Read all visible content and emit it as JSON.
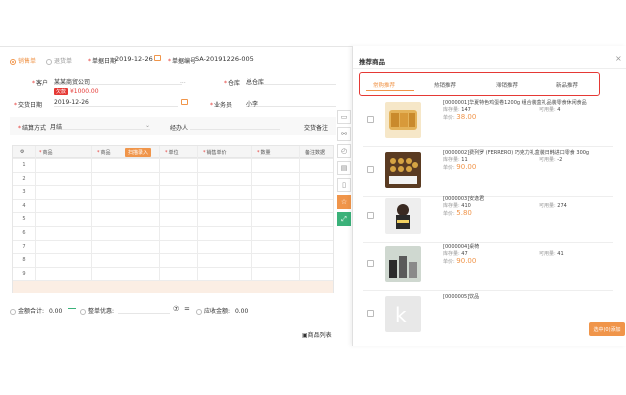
{
  "header": {
    "radio_options": [
      "销售单",
      "退货单"
    ],
    "date_label": "单据日期",
    "date_value": "2019-12-26",
    "bill_no_label": "单据编号",
    "bill_no_value": "SA-20191226-005"
  },
  "form": {
    "customer_label": "客户",
    "customer_value": "某某商贸公司",
    "customer_tag": "欠款",
    "customer_balance": "¥1000.00",
    "customer_dots": "...",
    "warehouse_label": "仓库",
    "warehouse_value": "总仓库",
    "delivery_date_label": "交货日期",
    "delivery_date_value": "2019-12-26",
    "salesperson_label": "业务员",
    "salesperson_value": "小李",
    "settle_label": "结算方式",
    "settle_value": "月结",
    "handler_label": "经办人",
    "note_label": "交货备注"
  },
  "grid": {
    "headers": [
      "商品",
      "商品",
      "单位",
      "销售单价",
      "数量",
      "备注数据"
    ],
    "scan_button": "扫描录入",
    "row_numbers": [
      "1",
      "2",
      "3",
      "4",
      "5",
      "6",
      "7",
      "8",
      "9",
      "合计"
    ]
  },
  "bottom": {
    "total_label": "金额合计:",
    "total_value": "0.00",
    "discount_label": "整单优惠:",
    "receivable_label": "应收金额:",
    "receivable_value": "0.00",
    "footer_text": "商品列表"
  },
  "right_panel": {
    "title": "推荐商品",
    "close": "×",
    "tabs": [
      "常购推荐",
      "热销推荐",
      "滞销推荐",
      "新品推荐"
    ],
    "active_tab": 0,
    "stock_label": "库存量:",
    "avail_label": "可用量:",
    "price_label": "单价:",
    "products": [
      {
        "name": "[0000001]华夏特色鸡蛋卷1200g 组合装盒礼品装零食休闲食品",
        "stock": "147",
        "avail": "4",
        "price": "38.00"
      },
      {
        "name": "[0000002]费列罗 (FERRERO) 巧克力礼盒装日韩进口零食 300g",
        "stock": "11",
        "avail": "-2",
        "price": "90.00"
      },
      {
        "name": "[0000003]安逸君",
        "stock": "410",
        "avail": "274",
        "price": "5.80"
      },
      {
        "name": "[0000004]桌椅",
        "stock": "47",
        "avail": "41",
        "price": "90.00"
      },
      {
        "name": "[0000005]饮品",
        "stock": "",
        "avail": "",
        "price": ""
      }
    ],
    "confirm_button": "选中(0)添加"
  }
}
